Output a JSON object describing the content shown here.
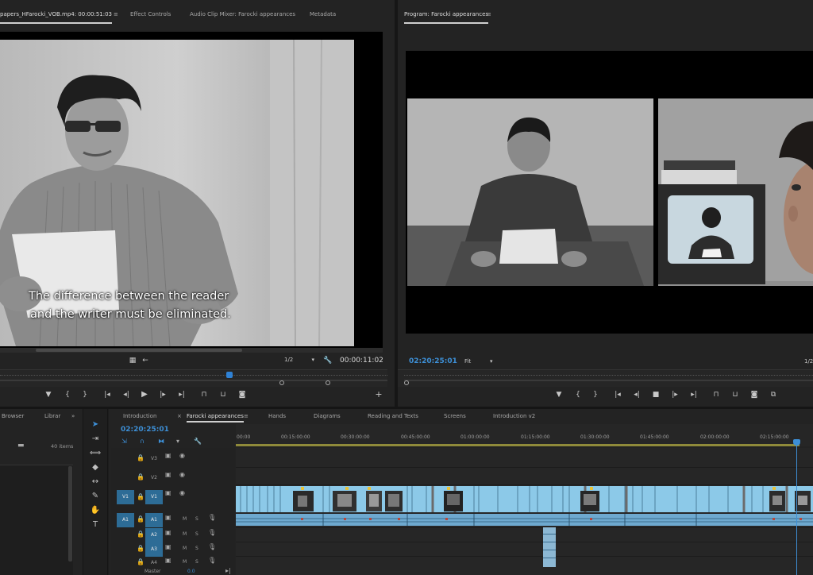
{
  "source_monitor": {
    "tabs": [
      {
        "label": "papers_HFarocki_VOB.mp4: 00:00:51:03",
        "active": true
      },
      {
        "label": "Effect Controls"
      },
      {
        "label": "Audio Clip Mixer: Farocki appearances"
      },
      {
        "label": "Metadata"
      }
    ],
    "subtitle_line1": "The difference between the reader",
    "subtitle_line2": "and the writer must be eliminated.",
    "zoom": "1/2",
    "timecode": "00:00:11:02"
  },
  "program_monitor": {
    "title": "Program: Farocki appearances",
    "timecode": "02:20:25:01",
    "fit": "Fit",
    "zoom": "1/2"
  },
  "project_panel": {
    "tabs": [
      "Browser",
      "Librar"
    ],
    "item_count": "40 items"
  },
  "timeline": {
    "timecode": "02:20:25:01",
    "tabs": [
      {
        "label": "Introduction"
      },
      {
        "label": "Farocki appearances",
        "active": true
      },
      {
        "label": "Hands"
      },
      {
        "label": "Diagrams"
      },
      {
        "label": "Reading and Texts"
      },
      {
        "label": "Screens"
      },
      {
        "label": "Introduction v2"
      }
    ],
    "ruler": [
      "00:00",
      "00:15:00:00",
      "00:30:00:00",
      "00:45:00:00",
      "01:00:00:00",
      "01:15:00:00",
      "01:30:00:00",
      "01:45:00:00",
      "02:00:00:00",
      "02:15:00:00"
    ],
    "tracks": {
      "v3": "V3",
      "v2": "V2",
      "v1": "V1",
      "v1_target": "V1",
      "a1_target": "A1",
      "a1": "A1",
      "a2": "A2",
      "a3": "A3",
      "a4": "A4",
      "master": "Master",
      "master_value": "0.0"
    },
    "mute": "M",
    "solo": "S"
  },
  "icons": {
    "selection": "selection-tool-icon",
    "track_select": "track-select-icon",
    "ripple": "ripple-edit-icon",
    "razor": "razor-icon",
    "slip": "slip-icon",
    "pen": "pen-icon",
    "hand": "hand-icon",
    "type": "type-icon"
  },
  "tool_type_glyph": "T"
}
